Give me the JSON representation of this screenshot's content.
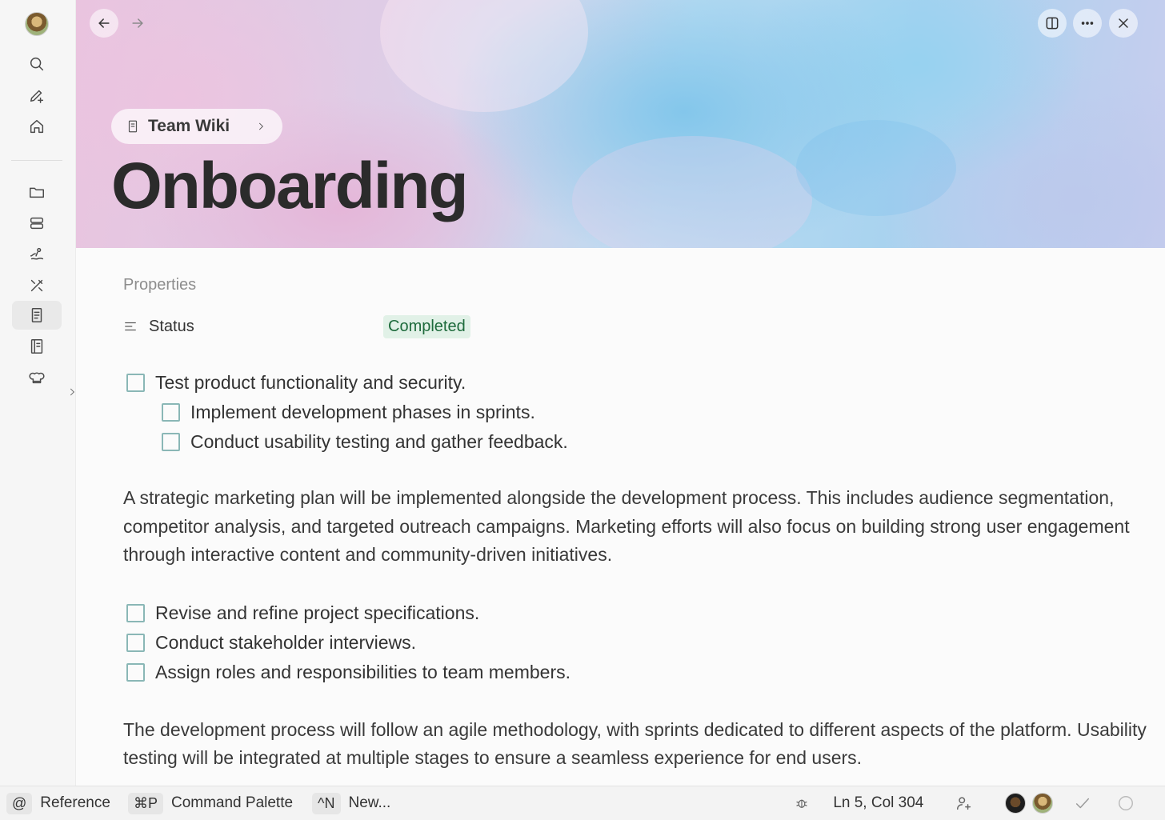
{
  "rail": {
    "items": [
      {
        "icon": "search-icon"
      },
      {
        "icon": "new-note-icon"
      },
      {
        "icon": "home-icon"
      },
      {
        "icon": "folder-icon"
      },
      {
        "icon": "database-icon"
      },
      {
        "icon": "beach-icon"
      },
      {
        "icon": "tools-icon"
      },
      {
        "icon": "document-icon",
        "active": true
      },
      {
        "icon": "notebook-icon"
      },
      {
        "icon": "chef-hat-icon"
      }
    ]
  },
  "cover": {
    "breadcrumb": "Team Wiki",
    "title": "Onboarding"
  },
  "properties": {
    "heading": "Properties",
    "status_label": "Status",
    "status_value": "Completed",
    "status_color": "#1e6b3c",
    "status_bg": "#e1f1e7"
  },
  "todos1": [
    {
      "text": "Test product functionality and security.",
      "nested": false
    },
    {
      "text": "Implement development phases in sprints.",
      "nested": true
    },
    {
      "text": "Conduct usability testing and gather feedback.",
      "nested": true
    }
  ],
  "para1": "A strategic marketing plan will be implemented alongside the development process. This includes audience segmentation, competitor analysis, and targeted outreach campaigns. Marketing efforts will also focus on building strong user engagement through interactive content and community-driven initiatives.",
  "todos2": [
    {
      "text": "Revise and refine project specifications."
    },
    {
      "text": "Conduct stakeholder interviews."
    },
    {
      "text": "Assign roles and responsibilities to team members."
    }
  ],
  "para2": "The development process will follow an agile methodology, with sprints dedicated to different aspects of the platform. Usability testing will be integrated at multiple stages to ensure a seamless experience for end users.",
  "statusbar": {
    "reference_key": "@",
    "reference_label": "Reference",
    "palette_key": "⌘P",
    "palette_label": "Command Palette",
    "new_key": "^N",
    "new_label": "New...",
    "cursor": "Ln 5, Col 304"
  }
}
